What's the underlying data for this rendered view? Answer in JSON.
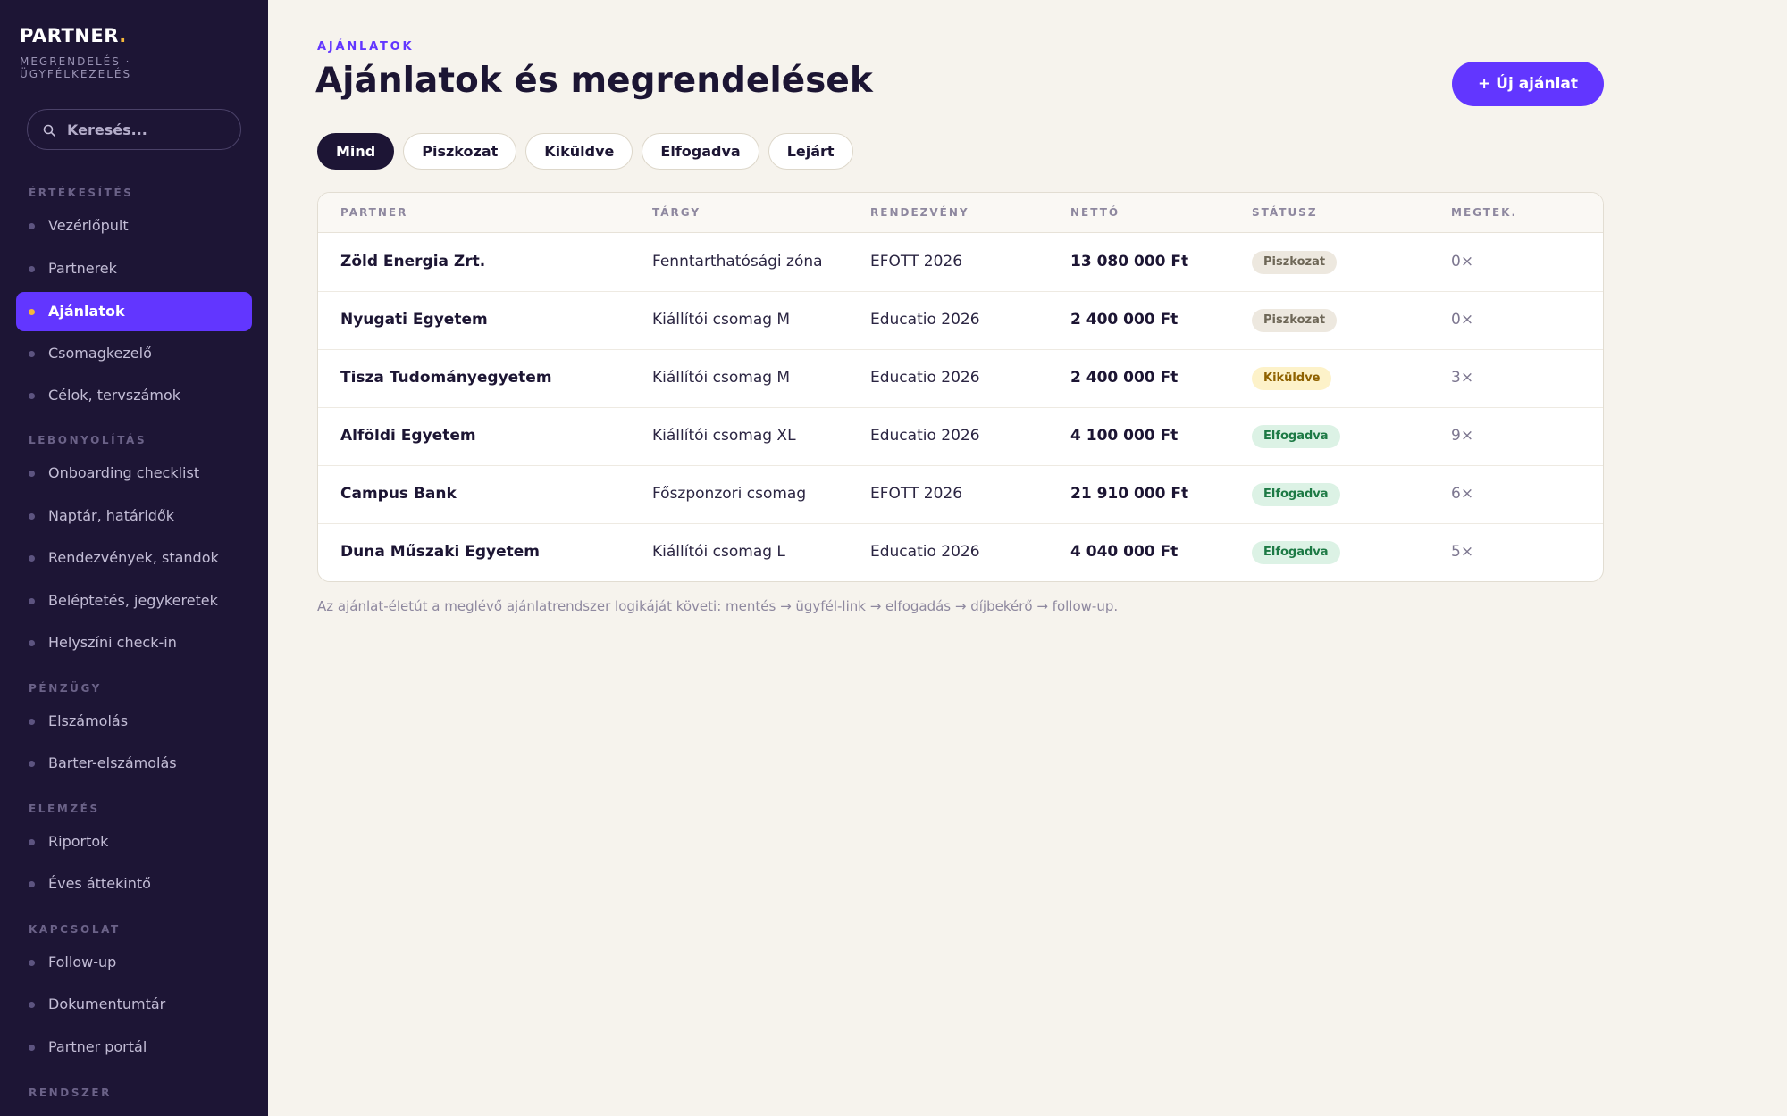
{
  "brand": {
    "name": "PARTNER",
    "dot": ".",
    "subtitle": "MEGRENDELÉS · ÜGYFÉLKEZELÉS"
  },
  "search": {
    "placeholder": "Keresés..."
  },
  "sidebar": {
    "sections": [
      {
        "title": "ÉRTÉKESÍTÉS"
      },
      {
        "title": "LEBONYOLÍTÁS"
      },
      {
        "title": "PÉNZÜGY"
      },
      {
        "title": "ELEMZÉS"
      },
      {
        "title": "KAPCSOLAT"
      },
      {
        "title": "RENDSZER"
      }
    ],
    "items": [
      {
        "label": "Vezérlőpult"
      },
      {
        "label": "Partnerek"
      },
      {
        "label": "Ajánlatok",
        "active": true
      },
      {
        "label": "Csomagkezelő"
      },
      {
        "label": "Célok, tervszámok"
      },
      {
        "label": "Onboarding checklist"
      },
      {
        "label": "Naptár, határidők"
      },
      {
        "label": "Rendezvények, standok"
      },
      {
        "label": "Beléptetés, jegykeretek"
      },
      {
        "label": "Helyszíni check-in"
      },
      {
        "label": "Elszámolás"
      },
      {
        "label": "Barter-elszámolás"
      },
      {
        "label": "Riportok"
      },
      {
        "label": "Éves áttekintő"
      },
      {
        "label": "Follow-up"
      },
      {
        "label": "Dokumentumtár"
      },
      {
        "label": "Partner portál"
      }
    ]
  },
  "header": {
    "eyebrow": "AJÁNLATOK",
    "title": "Ajánlatok és megrendelések",
    "new_button": "+ Új ajánlat"
  },
  "filters": [
    {
      "label": "Mind",
      "active": true
    },
    {
      "label": "Piszkozat"
    },
    {
      "label": "Kiküldve"
    },
    {
      "label": "Elfogadva"
    },
    {
      "label": "Lejárt"
    }
  ],
  "table": {
    "columns": [
      "PARTNER",
      "TÁRGY",
      "RENDEZVÉNY",
      "NETTÓ",
      "STÁTUSZ",
      "MEGTEK."
    ],
    "rows": [
      {
        "partner": "Zöld Energia Zrt.",
        "subject": "Fenntarthatósági zóna",
        "event": "EFOTT 2026",
        "net": "13 080 000 Ft",
        "status": "Piszkozat",
        "status_type": "draft",
        "views": "0×"
      },
      {
        "partner": "Nyugati Egyetem",
        "subject": "Kiállítói csomag M",
        "event": "Educatio 2026",
        "net": "2 400 000 Ft",
        "status": "Piszkozat",
        "status_type": "draft",
        "views": "0×"
      },
      {
        "partner": "Tisza Tudományegyetem",
        "subject": "Kiállítói csomag M",
        "event": "Educatio 2026",
        "net": "2 400 000 Ft",
        "status": "Kiküldve",
        "status_type": "sent",
        "views": "3×"
      },
      {
        "partner": "Alföldi Egyetem",
        "subject": "Kiállítói csomag XL",
        "event": "Educatio 2026",
        "net": "4 100 000 Ft",
        "status": "Elfogadva",
        "status_type": "accepted",
        "views": "9×"
      },
      {
        "partner": "Campus Bank",
        "subject": "Főszponzori csomag",
        "event": "EFOTT 2026",
        "net": "21 910 000 Ft",
        "status": "Elfogadva",
        "status_type": "accepted",
        "views": "6×"
      },
      {
        "partner": "Duna Műszaki Egyetem",
        "subject": "Kiállítói csomag L",
        "event": "Educatio 2026",
        "net": "4 040 000 Ft",
        "status": "Elfogadva",
        "status_type": "accepted",
        "views": "5×"
      }
    ]
  },
  "footnote": "Az ajánlat-életút a meglévő ajánlatrendszer logikáját követi: mentés → ügyfél-link → elfogadás → díjbekérő → follow-up.",
  "colors": {
    "accent": "#6236ff",
    "sidebar_bg": "#1d1535",
    "page_bg": "#f6f3ed",
    "brand_dot": "#f5b73a"
  },
  "icons": {
    "search": "search-icon"
  }
}
